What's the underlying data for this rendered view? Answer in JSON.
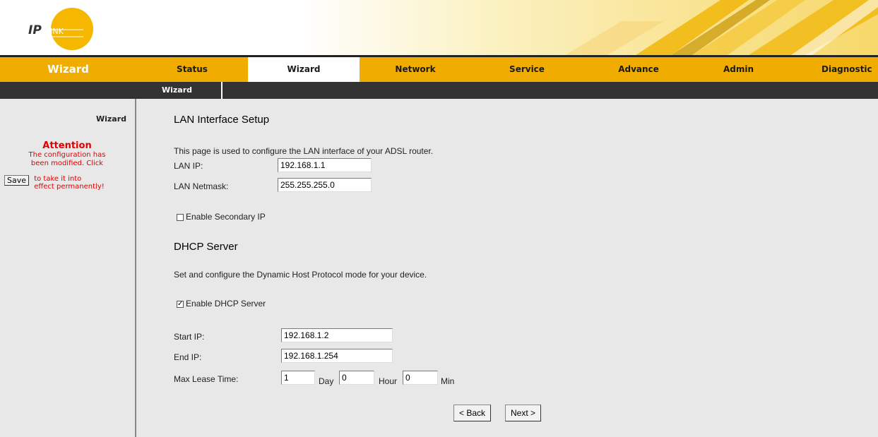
{
  "header": {
    "logo_text": "IPLINK",
    "section_title": "Wizard"
  },
  "tabs": [
    {
      "label": "Status"
    },
    {
      "label": "Wizard"
    },
    {
      "label": "Network"
    },
    {
      "label": "Service"
    },
    {
      "label": "Advance"
    },
    {
      "label": "Admin"
    },
    {
      "label": "Diagnostic"
    }
  ],
  "subtab": {
    "label": "Wizard"
  },
  "sidebar": {
    "wizard_label": "Wizard",
    "attention_title": "Attention",
    "attention_line1": "The configuration has",
    "attention_line2": "been modified. Click",
    "save_label": "Save",
    "after_save_line1": "to take it into",
    "after_save_line2": "effect permanently!"
  },
  "lan": {
    "title": "LAN Interface Setup",
    "description": "This page is used to configure the LAN interface of your ADSL router.",
    "ip_label": "LAN IP:",
    "ip_value": "192.168.1.1",
    "netmask_label": "LAN Netmask:",
    "netmask_value": "255.255.255.0",
    "secondary_label": "Enable Secondary IP",
    "secondary_checked": false
  },
  "dhcp": {
    "title": "DHCP Server",
    "description": "Set and configure the Dynamic Host Protocol mode for your device.",
    "enable_label": "Enable DHCP Server",
    "enable_checked": true,
    "start_label": "Start IP:",
    "start_value": "192.168.1.2",
    "end_label": "End IP:",
    "end_value": "192.168.1.254",
    "lease_label": "Max Lease Time:",
    "lease_day": "1",
    "day_unit": "Day",
    "lease_hour": "0",
    "hour_unit": "Hour",
    "lease_min": "0",
    "min_unit": "Min"
  },
  "nav": {
    "back_label": "< Back",
    "next_label": "Next >"
  },
  "colors": {
    "accent": "#f0ad00",
    "dark_bar": "#333333",
    "attention": "#e00000",
    "panel": "#e8e8e8"
  }
}
